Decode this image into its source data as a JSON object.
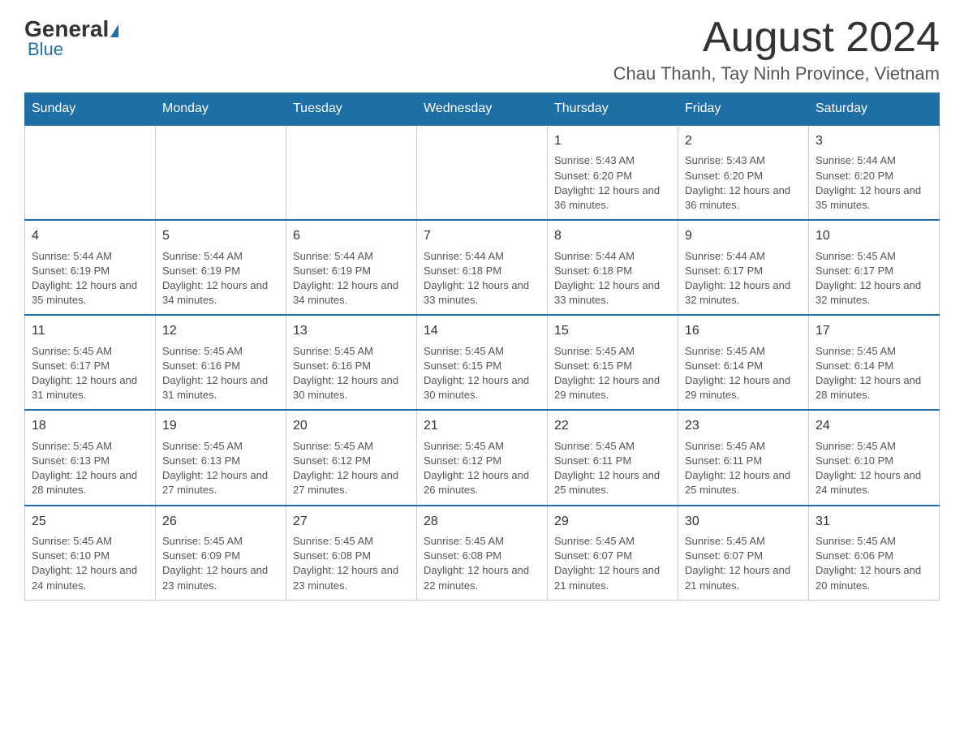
{
  "header": {
    "logo_general": "General",
    "logo_blue": "Blue",
    "month_title": "August 2024",
    "location": "Chau Thanh, Tay Ninh Province, Vietnam"
  },
  "weekdays": [
    "Sunday",
    "Monday",
    "Tuesday",
    "Wednesday",
    "Thursday",
    "Friday",
    "Saturday"
  ],
  "weeks": [
    [
      {
        "day": "",
        "sunrise": "",
        "sunset": "",
        "daylight": ""
      },
      {
        "day": "",
        "sunrise": "",
        "sunset": "",
        "daylight": ""
      },
      {
        "day": "",
        "sunrise": "",
        "sunset": "",
        "daylight": ""
      },
      {
        "day": "",
        "sunrise": "",
        "sunset": "",
        "daylight": ""
      },
      {
        "day": "1",
        "sunrise": "Sunrise: 5:43 AM",
        "sunset": "Sunset: 6:20 PM",
        "daylight": "Daylight: 12 hours and 36 minutes."
      },
      {
        "day": "2",
        "sunrise": "Sunrise: 5:43 AM",
        "sunset": "Sunset: 6:20 PM",
        "daylight": "Daylight: 12 hours and 36 minutes."
      },
      {
        "day": "3",
        "sunrise": "Sunrise: 5:44 AM",
        "sunset": "Sunset: 6:20 PM",
        "daylight": "Daylight: 12 hours and 35 minutes."
      }
    ],
    [
      {
        "day": "4",
        "sunrise": "Sunrise: 5:44 AM",
        "sunset": "Sunset: 6:19 PM",
        "daylight": "Daylight: 12 hours and 35 minutes."
      },
      {
        "day": "5",
        "sunrise": "Sunrise: 5:44 AM",
        "sunset": "Sunset: 6:19 PM",
        "daylight": "Daylight: 12 hours and 34 minutes."
      },
      {
        "day": "6",
        "sunrise": "Sunrise: 5:44 AM",
        "sunset": "Sunset: 6:19 PM",
        "daylight": "Daylight: 12 hours and 34 minutes."
      },
      {
        "day": "7",
        "sunrise": "Sunrise: 5:44 AM",
        "sunset": "Sunset: 6:18 PM",
        "daylight": "Daylight: 12 hours and 33 minutes."
      },
      {
        "day": "8",
        "sunrise": "Sunrise: 5:44 AM",
        "sunset": "Sunset: 6:18 PM",
        "daylight": "Daylight: 12 hours and 33 minutes."
      },
      {
        "day": "9",
        "sunrise": "Sunrise: 5:44 AM",
        "sunset": "Sunset: 6:17 PM",
        "daylight": "Daylight: 12 hours and 32 minutes."
      },
      {
        "day": "10",
        "sunrise": "Sunrise: 5:45 AM",
        "sunset": "Sunset: 6:17 PM",
        "daylight": "Daylight: 12 hours and 32 minutes."
      }
    ],
    [
      {
        "day": "11",
        "sunrise": "Sunrise: 5:45 AM",
        "sunset": "Sunset: 6:17 PM",
        "daylight": "Daylight: 12 hours and 31 minutes."
      },
      {
        "day": "12",
        "sunrise": "Sunrise: 5:45 AM",
        "sunset": "Sunset: 6:16 PM",
        "daylight": "Daylight: 12 hours and 31 minutes."
      },
      {
        "day": "13",
        "sunrise": "Sunrise: 5:45 AM",
        "sunset": "Sunset: 6:16 PM",
        "daylight": "Daylight: 12 hours and 30 minutes."
      },
      {
        "day": "14",
        "sunrise": "Sunrise: 5:45 AM",
        "sunset": "Sunset: 6:15 PM",
        "daylight": "Daylight: 12 hours and 30 minutes."
      },
      {
        "day": "15",
        "sunrise": "Sunrise: 5:45 AM",
        "sunset": "Sunset: 6:15 PM",
        "daylight": "Daylight: 12 hours and 29 minutes."
      },
      {
        "day": "16",
        "sunrise": "Sunrise: 5:45 AM",
        "sunset": "Sunset: 6:14 PM",
        "daylight": "Daylight: 12 hours and 29 minutes."
      },
      {
        "day": "17",
        "sunrise": "Sunrise: 5:45 AM",
        "sunset": "Sunset: 6:14 PM",
        "daylight": "Daylight: 12 hours and 28 minutes."
      }
    ],
    [
      {
        "day": "18",
        "sunrise": "Sunrise: 5:45 AM",
        "sunset": "Sunset: 6:13 PM",
        "daylight": "Daylight: 12 hours and 28 minutes."
      },
      {
        "day": "19",
        "sunrise": "Sunrise: 5:45 AM",
        "sunset": "Sunset: 6:13 PM",
        "daylight": "Daylight: 12 hours and 27 minutes."
      },
      {
        "day": "20",
        "sunrise": "Sunrise: 5:45 AM",
        "sunset": "Sunset: 6:12 PM",
        "daylight": "Daylight: 12 hours and 27 minutes."
      },
      {
        "day": "21",
        "sunrise": "Sunrise: 5:45 AM",
        "sunset": "Sunset: 6:12 PM",
        "daylight": "Daylight: 12 hours and 26 minutes."
      },
      {
        "day": "22",
        "sunrise": "Sunrise: 5:45 AM",
        "sunset": "Sunset: 6:11 PM",
        "daylight": "Daylight: 12 hours and 25 minutes."
      },
      {
        "day": "23",
        "sunrise": "Sunrise: 5:45 AM",
        "sunset": "Sunset: 6:11 PM",
        "daylight": "Daylight: 12 hours and 25 minutes."
      },
      {
        "day": "24",
        "sunrise": "Sunrise: 5:45 AM",
        "sunset": "Sunset: 6:10 PM",
        "daylight": "Daylight: 12 hours and 24 minutes."
      }
    ],
    [
      {
        "day": "25",
        "sunrise": "Sunrise: 5:45 AM",
        "sunset": "Sunset: 6:10 PM",
        "daylight": "Daylight: 12 hours and 24 minutes."
      },
      {
        "day": "26",
        "sunrise": "Sunrise: 5:45 AM",
        "sunset": "Sunset: 6:09 PM",
        "daylight": "Daylight: 12 hours and 23 minutes."
      },
      {
        "day": "27",
        "sunrise": "Sunrise: 5:45 AM",
        "sunset": "Sunset: 6:08 PM",
        "daylight": "Daylight: 12 hours and 23 minutes."
      },
      {
        "day": "28",
        "sunrise": "Sunrise: 5:45 AM",
        "sunset": "Sunset: 6:08 PM",
        "daylight": "Daylight: 12 hours and 22 minutes."
      },
      {
        "day": "29",
        "sunrise": "Sunrise: 5:45 AM",
        "sunset": "Sunset: 6:07 PM",
        "daylight": "Daylight: 12 hours and 21 minutes."
      },
      {
        "day": "30",
        "sunrise": "Sunrise: 5:45 AM",
        "sunset": "Sunset: 6:07 PM",
        "daylight": "Daylight: 12 hours and 21 minutes."
      },
      {
        "day": "31",
        "sunrise": "Sunrise: 5:45 AM",
        "sunset": "Sunset: 6:06 PM",
        "daylight": "Daylight: 12 hours and 20 minutes."
      }
    ]
  ]
}
